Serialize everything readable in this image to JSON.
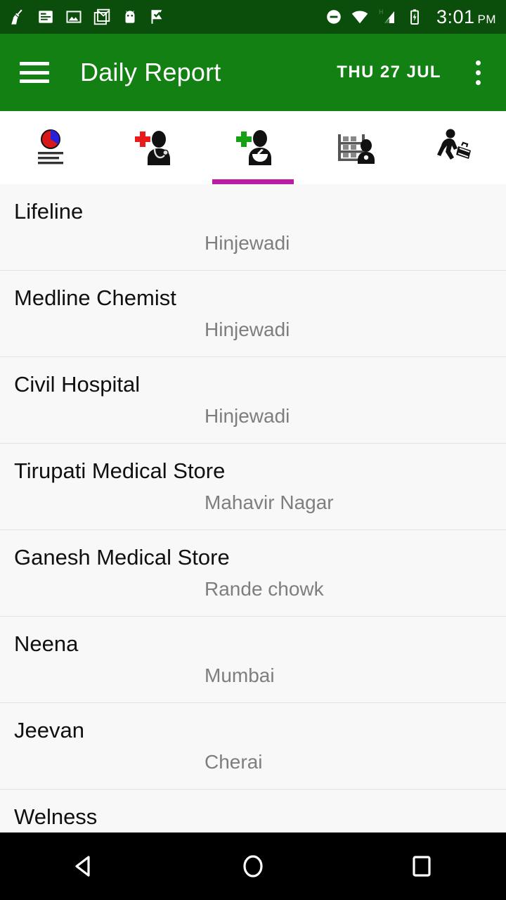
{
  "status_bar": {
    "time": "3:01",
    "ampm": "PM",
    "network_label": "H",
    "background": "#0B4D0B",
    "left_icons": [
      "broom-cleaner-icon",
      "news-document-icon",
      "photo-image-icon",
      "gmail-icon",
      "android-robot-icon",
      "checkmark-flag-icon"
    ],
    "right_icons": [
      "do-not-disturb-icon",
      "wifi-icon",
      "cellular-signal-icon",
      "battery-charging-icon"
    ]
  },
  "app_bar": {
    "title": "Daily Report",
    "date": "THU 27 JUL",
    "menu_icon": "hamburger-menu-icon",
    "overflow_icon": "overflow-menu-icon",
    "background": "#128012"
  },
  "tabs": {
    "active_index": 2,
    "indicator_color": "#BB1BA5",
    "items": [
      {
        "name": "report",
        "icon": "report-pie-chart-icon"
      },
      {
        "name": "doctor",
        "icon": "doctor-red-cross-icon"
      },
      {
        "name": "chemist",
        "icon": "pharmacist-green-cross-icon"
      },
      {
        "name": "stockist",
        "icon": "stockist-shelf-icon"
      },
      {
        "name": "field-rep",
        "icon": "field-rep-briefcase-icon"
      }
    ]
  },
  "list": {
    "rows": [
      {
        "name": "Lifeline",
        "location": "Hinjewadi"
      },
      {
        "name": "Medline Chemist",
        "location": "Hinjewadi"
      },
      {
        "name": "Civil Hospital",
        "location": "Hinjewadi"
      },
      {
        "name": "Tirupati Medical Store",
        "location": "Mahavir Nagar"
      },
      {
        "name": "Ganesh Medical Store",
        "location": "Rande chowk"
      },
      {
        "name": "Neena",
        "location": "Mumbai"
      },
      {
        "name": "Jeevan",
        "location": "Cherai"
      },
      {
        "name": "Welness",
        "location": ""
      }
    ]
  },
  "nav_bar": {
    "background": "#000000",
    "buttons": [
      {
        "name": "back",
        "icon": "back-triangle-icon"
      },
      {
        "name": "home",
        "icon": "home-circle-icon"
      },
      {
        "name": "recents",
        "icon": "recents-square-icon"
      }
    ]
  }
}
